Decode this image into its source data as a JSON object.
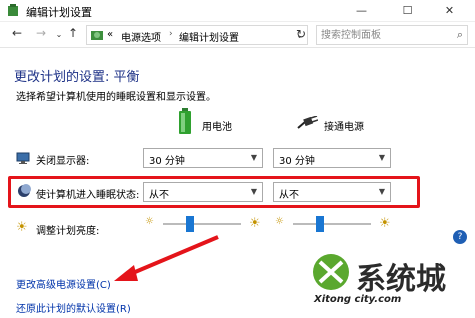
{
  "window": {
    "title": "编辑计划设置",
    "min_label": "—",
    "max_label": "☐",
    "close_label": "✕"
  },
  "nav": {
    "back": "←",
    "forward": "→",
    "history": "⌄",
    "up": "↑",
    "breadcrumb_prefix": "«",
    "crumb1": "电源选项",
    "separator": "›",
    "crumb2": "编辑计划设置",
    "dropdown": "⌄",
    "refresh": "↻",
    "search_placeholder": "搜索控制面板",
    "search_icon": "⌕"
  },
  "main": {
    "heading": "更改计划的设置: 平衡",
    "subheading": "选择希望计算机使用的睡眠设置和显示设置。",
    "col_battery": "用电池",
    "col_plugged": "接通电源",
    "rows": {
      "display_label": "关闭显示器:",
      "display_battery": "30 分钟",
      "display_plugged": "30 分钟",
      "sleep_label": "使计算机进入睡眠状态:",
      "sleep_battery": "从不",
      "sleep_plugged": "从不",
      "brightness_label": "调整计划亮度:",
      "brightness_battery": 0.35,
      "brightness_plugged": 0.35
    },
    "link_advanced": "更改高级电源设置(C)",
    "link_restore": "还原此计划的默认设置(R)",
    "help": "?"
  },
  "watermark": {
    "logo": "系统城",
    "url": "Xitong city.com"
  },
  "colors": {
    "heading": "#1e3287",
    "link": "#0033aa",
    "highlight": "#e4141a",
    "slider_thumb": "#1976d2"
  },
  "icons": [
    "app-icon",
    "control-panel-icon",
    "battery-icon",
    "plug-icon",
    "monitor-icon",
    "moon-icon",
    "sun-icon",
    "arrow-annotation"
  ]
}
